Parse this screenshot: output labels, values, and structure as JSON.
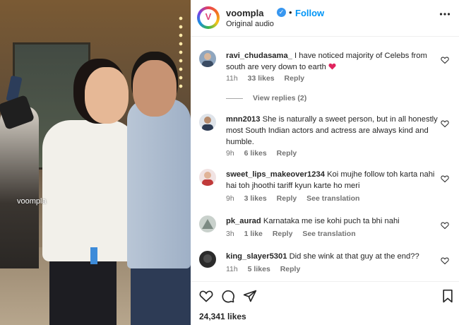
{
  "media": {
    "watermark": "voompla"
  },
  "header": {
    "logo_letter": "V",
    "username": "voompla",
    "verified_glyph": "✓",
    "separator": "•",
    "follow_label": "Follow",
    "audio": "Original audio",
    "more_icon": "more-options-icon"
  },
  "comments": [
    {
      "user": "ravi_chudasama_",
      "text": "I have noticed majority of Celebs from south are very down to earth",
      "emoji": "heart-emoji",
      "time": "11h",
      "likes": "33 likes",
      "reply": "Reply",
      "view_replies": "View replies (2)",
      "avatar_color": "#8fa6bf"
    },
    {
      "user": "mnn2013",
      "text": "She is naturally a sweet person, but in all honestly most South Indian actors and actress are always kind and humble.",
      "time": "9h",
      "likes": "6 likes",
      "reply": "Reply",
      "avatar_color": "#4a5a70"
    },
    {
      "user": "sweet_lips_makeover1234",
      "text": "Koi mujhe follow toh karta nahi hai toh jhoothi tariff kyun karte ho meri",
      "time": "9h",
      "likes": "3 likes",
      "reply": "Reply",
      "see_translation": "See translation",
      "avatar_color": "#c03a3a"
    },
    {
      "user": "pk_aurad",
      "text": "Karnataka me ise kohi puch ta bhi nahi",
      "time": "3h",
      "likes": "1 like",
      "reply": "Reply",
      "see_translation": "See translation",
      "avatar_color": "#9aa7a2"
    },
    {
      "user": "king_slayer5301",
      "text": "Did she wink at that guy at the end??",
      "time": "11h",
      "likes": "5 likes",
      "reply": "Reply",
      "avatar_color": "#2b2b2b"
    }
  ],
  "footer": {
    "likes": "24,341 likes"
  },
  "colors": {
    "link_blue": "#0095f6",
    "heart_red": "#ed4956",
    "muted": "#737373"
  }
}
